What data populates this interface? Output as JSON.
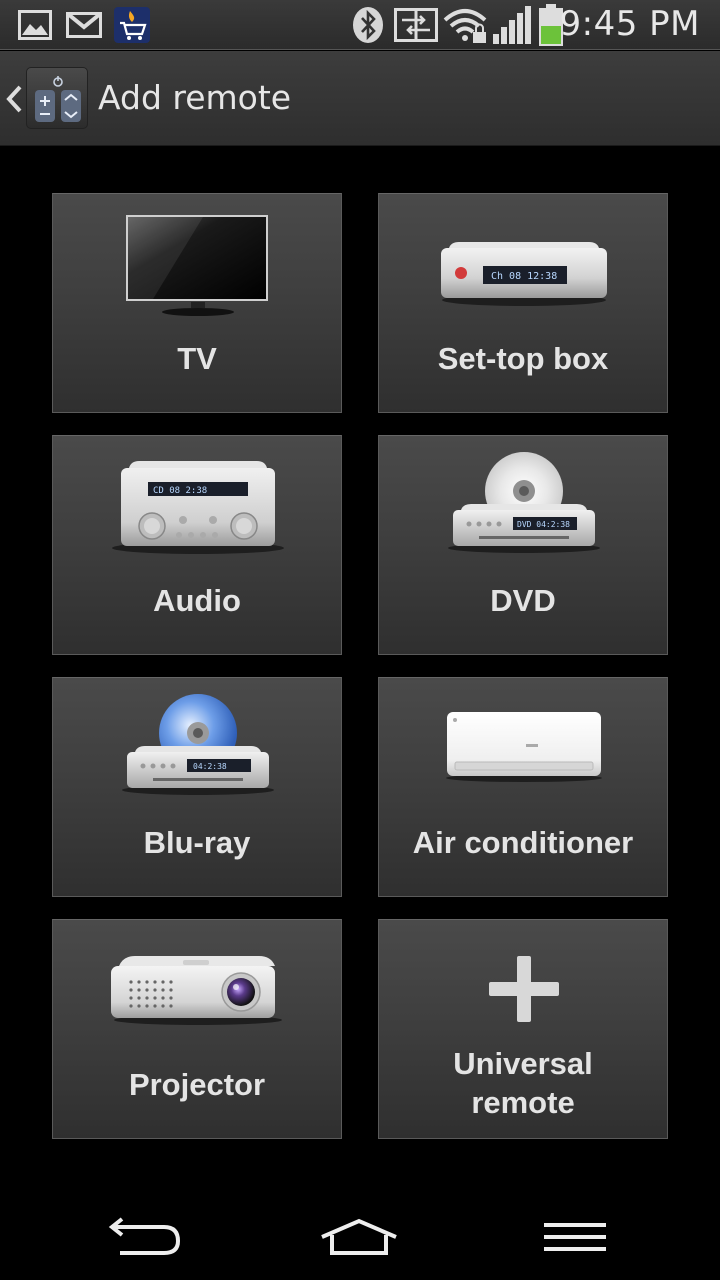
{
  "status_bar": {
    "time": "9:45 PM",
    "icons": [
      "gallery-notification-icon",
      "gmail-icon",
      "shopping-app-icon",
      "bluetooth-icon",
      "data-sync-icon",
      "wifi-locked-icon",
      "signal-icon",
      "battery-icon"
    ]
  },
  "action_bar": {
    "title": "Add remote",
    "back_icon": "chevron-left-icon",
    "app_icon": "remote-app-icon"
  },
  "devices": [
    {
      "label": "TV",
      "icon": "tv-icon"
    },
    {
      "label": "Set-top box",
      "icon": "set-top-box-icon",
      "display": "Ch 08   12:38"
    },
    {
      "label": "Audio",
      "icon": "audio-icon",
      "display": "CD 08   2:38"
    },
    {
      "label": "DVD",
      "icon": "dvd-icon",
      "display": "DVD  04:2:38"
    },
    {
      "label": "Blu-ray",
      "icon": "blu-ray-icon",
      "display": "04:2:38"
    },
    {
      "label": "Air conditioner",
      "icon": "air-conditioner-icon"
    },
    {
      "label": "Projector",
      "icon": "projector-icon"
    },
    {
      "label": "Universal remote",
      "label_line1": "Universal",
      "label_line2": "remote",
      "icon": "plus-icon"
    }
  ],
  "nav_bar": {
    "buttons": [
      "back-icon",
      "home-icon",
      "menu-icon"
    ]
  },
  "colors": {
    "background": "#000000",
    "tile": "#3f3f3f",
    "text": "#e4e4e4",
    "battery": "#6cc23a"
  }
}
